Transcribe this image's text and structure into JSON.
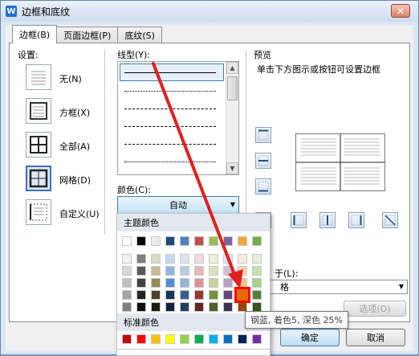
{
  "window": {
    "title": "边框和底纹",
    "close_glyph": "✕",
    "app_icon_glyph": "W"
  },
  "tabs": [
    {
      "label": "边框(B)",
      "active": true
    },
    {
      "label": "页面边框(P)",
      "active": false
    },
    {
      "label": "底纹(S)",
      "active": false
    }
  ],
  "settings": {
    "heading": "设置:",
    "items": [
      {
        "label": "无(N)",
        "icon": "border-none-icon"
      },
      {
        "label": "方框(X)",
        "icon": "border-box-icon"
      },
      {
        "label": "全部(A)",
        "icon": "border-all-icon"
      },
      {
        "label": "网格(D)",
        "icon": "border-grid-icon",
        "selected": true
      },
      {
        "label": "自定义(U)",
        "icon": "border-custom-icon"
      }
    ]
  },
  "line_style": {
    "heading": "线型(Y):"
  },
  "color": {
    "heading": "颜色(C):",
    "value": "自动"
  },
  "preview": {
    "heading": "预览",
    "hint": "单击下方图示或按钮可设置边框"
  },
  "apply_to": {
    "heading_tail": "于(L):",
    "value_tail": "格"
  },
  "palette": {
    "theme_heading": "主题颜色",
    "standard_heading": "标准颜色",
    "theme_top": [
      "#ffffff",
      "#000000",
      "#eeece1",
      "#1f497d",
      "#4f81bd",
      "#c0504d",
      "#9bbb59",
      "#8064a2",
      "#f2a53c",
      "#70ad47"
    ],
    "theme_grid": [
      [
        "#f2f2f2",
        "#7f7f7f",
        "#ddd9c3",
        "#c6d9f0",
        "#dbe5f1",
        "#f2dcdb",
        "#ebf1dd",
        "#e5e0ec",
        "#fdeada",
        "#e2efd9"
      ],
      [
        "#d8d8d8",
        "#595959",
        "#c4bd97",
        "#8db3e2",
        "#b8cce4",
        "#e5b9b7",
        "#d7e3bc",
        "#ccc1d9",
        "#fbd5b5",
        "#c5e0b3"
      ],
      [
        "#bfbfbf",
        "#3f3f3f",
        "#938953",
        "#548dd4",
        "#95b3d7",
        "#d99694",
        "#c3d69b",
        "#b2a2c7",
        "#fac08f",
        "#a8d08d"
      ],
      [
        "#a5a5a5",
        "#262626",
        "#494429",
        "#17365d",
        "#366092",
        "#953734",
        "#76923c",
        "#5f497a",
        "#e36c09",
        "#538135"
      ],
      [
        "#7f7f7f",
        "#0c0c0c",
        "#1d1b10",
        "#0f243e",
        "#244061",
        "#632423",
        "#4f6128",
        "#3f3151",
        "#974806",
        "#375623"
      ]
    ],
    "standard": [
      "#c00000",
      "#ff0000",
      "#ffc000",
      "#ffff00",
      "#92d050",
      "#00b050",
      "#00b0f0",
      "#0070c0",
      "#002060",
      "#7030a0"
    ],
    "highlight_color": "#ff0000"
  },
  "tooltip": {
    "text": "钢蓝, 着色5, 深色 25%"
  },
  "buttons": {
    "options": "选项(O)",
    "ok": "确定",
    "cancel": "取消"
  },
  "annotation": {
    "arrow_color": "#e02020"
  }
}
